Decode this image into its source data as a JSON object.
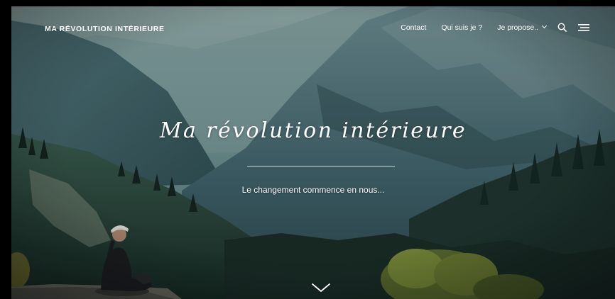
{
  "header": {
    "site_title": "MA RÉVOLUTION INTÉRIEURE",
    "nav": [
      {
        "label": "Contact"
      },
      {
        "label": "Qui suis je ?"
      },
      {
        "label": "Je propose..",
        "has_dropdown": true
      }
    ],
    "icons": [
      "search-icon",
      "menu-icon"
    ]
  },
  "hero": {
    "title": "Ma révolution intérieure",
    "subtitle": "Le changement commence en nous...",
    "scroll_icon": "chevron-down-icon"
  },
  "colors": {
    "text": "#ffffff",
    "sky": "#8aa6a3",
    "mountain_mid": "#4a6d70",
    "forest": "#1c2f27"
  }
}
